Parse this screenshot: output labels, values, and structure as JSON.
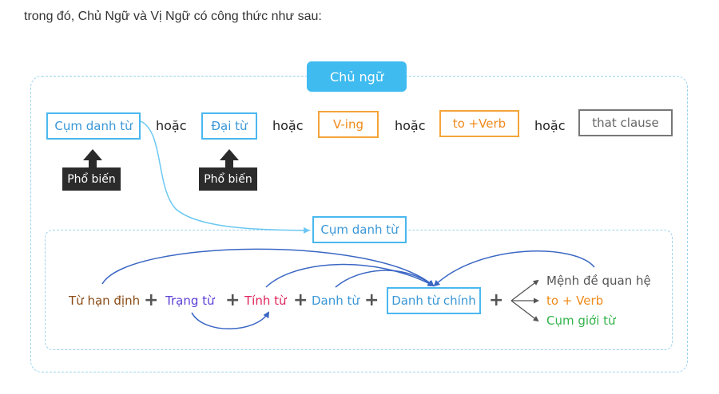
{
  "intro_text": "trong đó, Chủ Ngữ và Vị Ngữ có công thức như sau:",
  "diagram": {
    "title": "Chủ ngữ",
    "options": [
      {
        "label": "Cụm danh từ",
        "style": "blue"
      },
      {
        "label": "Đại từ",
        "style": "blue"
      },
      {
        "label": "V-ing",
        "style": "orange"
      },
      {
        "label": "to +Verb",
        "style": "orange"
      },
      {
        "label": "that clause",
        "style": "gray"
      }
    ],
    "or_word": "hoặc",
    "common_label": "Phổ biến",
    "noun_phrase": {
      "title": "Cụm danh từ",
      "components": [
        {
          "label": "Từ hạn định",
          "color": "#8a4a14"
        },
        {
          "label": "Trạng từ",
          "color": "#5b3fd6"
        },
        {
          "label": "Tính từ",
          "color": "#e0245a"
        },
        {
          "label": "Danh từ",
          "color": "#3a97d8"
        }
      ],
      "head_noun": "Danh từ chính",
      "post_modifiers": [
        {
          "label": "Mệnh đề quan hệ",
          "color": "#555555"
        },
        {
          "label": "to + Verb",
          "color": "#ef8a1a"
        },
        {
          "label": "Cụm giới từ",
          "color": "#33b34a"
        }
      ]
    },
    "colors": {
      "accent": "#3fbbf0",
      "box_blue": "#4ab8ef",
      "box_orange": "#f4a43a",
      "box_gray": "#777777",
      "dashed": "#9cd3ef",
      "curve": "#3a66c4"
    }
  }
}
